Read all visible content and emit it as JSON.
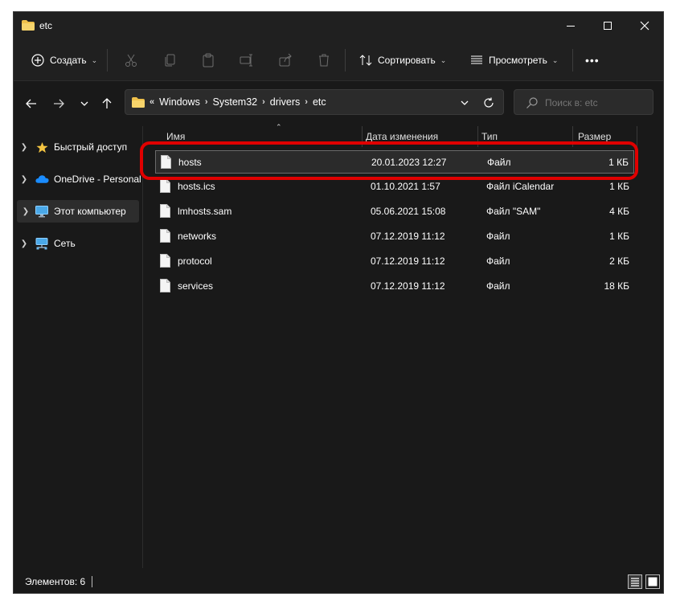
{
  "window": {
    "title": "etc"
  },
  "commandbar": {
    "create_label": "Создать",
    "sort_label": "Сортировать",
    "view_label": "Просмотреть",
    "more_label": "•••"
  },
  "address": {
    "overflow": "«",
    "crumbs": [
      "Windows",
      "System32",
      "drivers",
      "etc"
    ]
  },
  "search": {
    "placeholder": "Поиск в: etc"
  },
  "navigation": {
    "items": [
      {
        "label": "Быстрый доступ",
        "icon": "star-icon"
      },
      {
        "label": "OneDrive - Personal",
        "icon": "cloud-icon"
      },
      {
        "label": "Этот компьютер",
        "icon": "monitor-icon",
        "selected": true
      },
      {
        "label": "Сеть",
        "icon": "network-icon"
      }
    ]
  },
  "columns": {
    "name": "Имя",
    "date": "Дата изменения",
    "type": "Тип",
    "size": "Размер"
  },
  "files": [
    {
      "name": "hosts",
      "date": "20.01.2023 12:27",
      "type": "Файл",
      "size": "1 КБ",
      "selected": true
    },
    {
      "name": "hosts.ics",
      "date": "01.10.2021 1:57",
      "type": "Файл iCalendar",
      "size": "1 КБ"
    },
    {
      "name": "lmhosts.sam",
      "date": "05.06.2021 15:08",
      "type": "Файл \"SAM\"",
      "size": "4 КБ"
    },
    {
      "name": "networks",
      "date": "07.12.2019 11:12",
      "type": "Файл",
      "size": "1 КБ"
    },
    {
      "name": "protocol",
      "date": "07.12.2019 11:12",
      "type": "Файл",
      "size": "2 КБ"
    },
    {
      "name": "services",
      "date": "07.12.2019 11:12",
      "type": "Файл",
      "size": "18 КБ"
    }
  ],
  "status": {
    "items_text": "Элементов: 6"
  },
  "colors": {
    "background": "#191919",
    "highlight": "#e00000",
    "folder": "#f0c14b"
  }
}
